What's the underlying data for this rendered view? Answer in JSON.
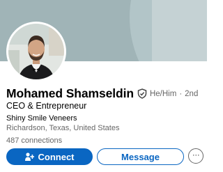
{
  "profile": {
    "name": "Mohamed Shamseldin",
    "pronouns": "He/Him",
    "separator": "·",
    "degree": "2nd",
    "headline": "CEO & Entrepreneur",
    "company": "Shiny Smile Veneers",
    "location": "Richardson, Texas, United States",
    "connections": "487 connections"
  },
  "actions": {
    "connect_label": "Connect",
    "message_label": "Message",
    "more_label": "···"
  },
  "icons": {
    "verified": "shield-check-icon",
    "connect": "add-person-icon",
    "more": "more-horizontal-icon"
  },
  "colors": {
    "accent": "#0a66c2",
    "banner": "#a0b4b7",
    "secondary_text": "#666666"
  }
}
